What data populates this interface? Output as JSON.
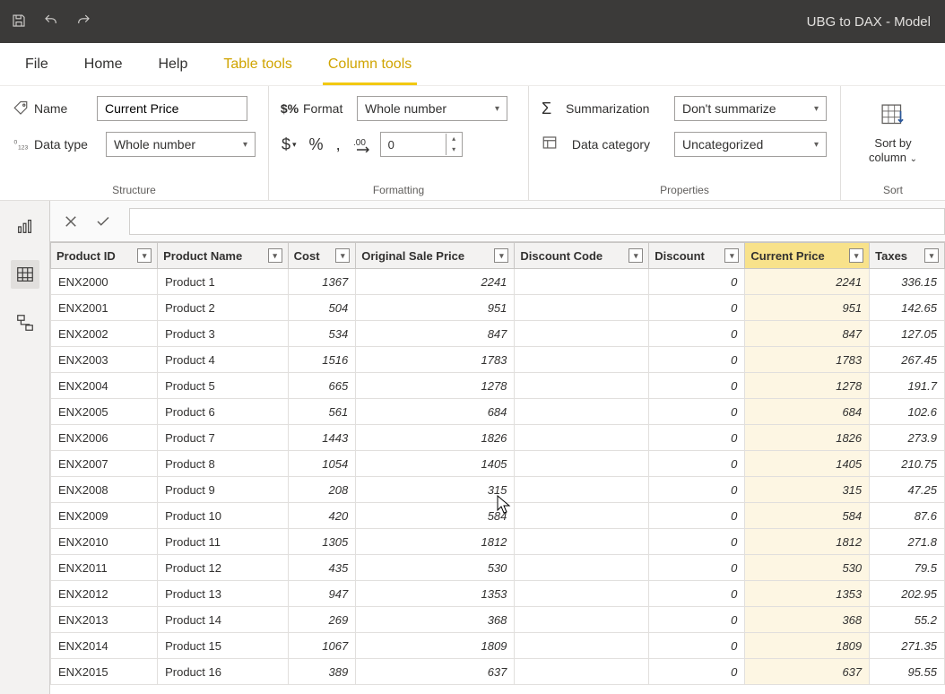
{
  "titlebar": {
    "title": "UBG to DAX - Model"
  },
  "tabs": {
    "file": "File",
    "home": "Home",
    "help": "Help",
    "table_tools": "Table tools",
    "column_tools": "Column tools"
  },
  "ribbon": {
    "structure": {
      "name_label": "Name",
      "name_value": "Current Price",
      "datatype_label": "Data type",
      "datatype_value": "Whole number",
      "group_label": "Structure"
    },
    "formatting": {
      "format_label": "Format",
      "format_value": "Whole number",
      "currency": "$",
      "percent": "%",
      "comma": ",",
      "deczero": "0",
      "group_label": "Formatting"
    },
    "properties": {
      "summ_label": "Summarization",
      "summ_value": "Don't summarize",
      "cat_label": "Data category",
      "cat_value": "Uncategorized",
      "group_label": "Properties"
    },
    "sort": {
      "label": "Sort by\ncolumn",
      "group_label": "Sort"
    }
  },
  "columns": [
    {
      "key": "product_id",
      "label": "Product ID",
      "numeric": false,
      "selected": false
    },
    {
      "key": "product_name",
      "label": "Product Name",
      "numeric": false,
      "selected": false
    },
    {
      "key": "cost",
      "label": "Cost",
      "numeric": true,
      "selected": false
    },
    {
      "key": "original_sale_price",
      "label": "Original Sale Price",
      "numeric": true,
      "selected": false
    },
    {
      "key": "discount_code",
      "label": "Discount Code",
      "numeric": false,
      "selected": false
    },
    {
      "key": "discount",
      "label": "Discount",
      "numeric": true,
      "selected": false
    },
    {
      "key": "current_price",
      "label": "Current Price",
      "numeric": true,
      "selected": true
    },
    {
      "key": "taxes",
      "label": "Taxes",
      "numeric": true,
      "selected": false
    }
  ],
  "rows": [
    {
      "product_id": "ENX2000",
      "product_name": "Product 1",
      "cost": "1367",
      "original_sale_price": "2241",
      "discount_code": "",
      "discount": "0",
      "current_price": "2241",
      "taxes": "336.15"
    },
    {
      "product_id": "ENX2001",
      "product_name": "Product 2",
      "cost": "504",
      "original_sale_price": "951",
      "discount_code": "",
      "discount": "0",
      "current_price": "951",
      "taxes": "142.65"
    },
    {
      "product_id": "ENX2002",
      "product_name": "Product 3",
      "cost": "534",
      "original_sale_price": "847",
      "discount_code": "",
      "discount": "0",
      "current_price": "847",
      "taxes": "127.05"
    },
    {
      "product_id": "ENX2003",
      "product_name": "Product 4",
      "cost": "1516",
      "original_sale_price": "1783",
      "discount_code": "",
      "discount": "0",
      "current_price": "1783",
      "taxes": "267.45"
    },
    {
      "product_id": "ENX2004",
      "product_name": "Product 5",
      "cost": "665",
      "original_sale_price": "1278",
      "discount_code": "",
      "discount": "0",
      "current_price": "1278",
      "taxes": "191.7"
    },
    {
      "product_id": "ENX2005",
      "product_name": "Product 6",
      "cost": "561",
      "original_sale_price": "684",
      "discount_code": "",
      "discount": "0",
      "current_price": "684",
      "taxes": "102.6"
    },
    {
      "product_id": "ENX2006",
      "product_name": "Product 7",
      "cost": "1443",
      "original_sale_price": "1826",
      "discount_code": "",
      "discount": "0",
      "current_price": "1826",
      "taxes": "273.9"
    },
    {
      "product_id": "ENX2007",
      "product_name": "Product 8",
      "cost": "1054",
      "original_sale_price": "1405",
      "discount_code": "",
      "discount": "0",
      "current_price": "1405",
      "taxes": "210.75"
    },
    {
      "product_id": "ENX2008",
      "product_name": "Product 9",
      "cost": "208",
      "original_sale_price": "315",
      "discount_code": "",
      "discount": "0",
      "current_price": "315",
      "taxes": "47.25"
    },
    {
      "product_id": "ENX2009",
      "product_name": "Product 10",
      "cost": "420",
      "original_sale_price": "584",
      "discount_code": "",
      "discount": "0",
      "current_price": "584",
      "taxes": "87.6"
    },
    {
      "product_id": "ENX2010",
      "product_name": "Product 11",
      "cost": "1305",
      "original_sale_price": "1812",
      "discount_code": "",
      "discount": "0",
      "current_price": "1812",
      "taxes": "271.8"
    },
    {
      "product_id": "ENX2011",
      "product_name": "Product 12",
      "cost": "435",
      "original_sale_price": "530",
      "discount_code": "",
      "discount": "0",
      "current_price": "530",
      "taxes": "79.5"
    },
    {
      "product_id": "ENX2012",
      "product_name": "Product 13",
      "cost": "947",
      "original_sale_price": "1353",
      "discount_code": "",
      "discount": "0",
      "current_price": "1353",
      "taxes": "202.95"
    },
    {
      "product_id": "ENX2013",
      "product_name": "Product 14",
      "cost": "269",
      "original_sale_price": "368",
      "discount_code": "",
      "discount": "0",
      "current_price": "368",
      "taxes": "55.2"
    },
    {
      "product_id": "ENX2014",
      "product_name": "Product 15",
      "cost": "1067",
      "original_sale_price": "1809",
      "discount_code": "",
      "discount": "0",
      "current_price": "1809",
      "taxes": "271.35"
    },
    {
      "product_id": "ENX2015",
      "product_name": "Product 16",
      "cost": "389",
      "original_sale_price": "637",
      "discount_code": "",
      "discount": "0",
      "current_price": "637",
      "taxes": "95.55"
    }
  ]
}
